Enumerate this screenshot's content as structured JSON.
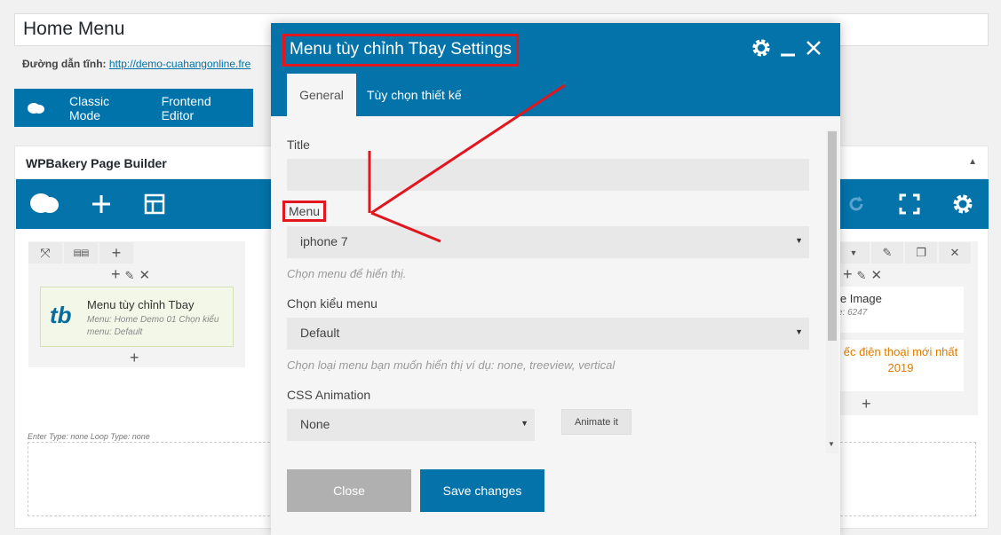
{
  "post": {
    "title": "Home Menu",
    "permalink_label": "Đường dẫn tĩnh:",
    "permalink_url": "http://demo-cuahangonline.fre"
  },
  "modes": {
    "classic": "Classic Mode",
    "frontend": "Frontend Editor"
  },
  "builder": {
    "heading": "WPBakery Page Builder",
    "element": {
      "logo": "tb",
      "name": "Menu tùy chỉnh Tbay",
      "desc": "Menu: Home Demo 01  Chọn kiểu menu: Default"
    },
    "enter_type": "Enter Type: none  Loop Type: none",
    "right": {
      "card1_title": "le Image",
      "card1_sub": "e: 6247",
      "card2_line1": "ếc điện thoại mới nhất",
      "card2_line2": "2019"
    }
  },
  "modal": {
    "title": "Menu tùy chỉnh Tbay Settings",
    "tabs": [
      "General",
      "Tùy chọn thiết kế"
    ],
    "fields": {
      "title_label": "Title",
      "title_value": "",
      "menu_label": "Menu",
      "menu_value": "iphone 7",
      "menu_hint": "Chọn menu để hiển thị.",
      "style_label": "Chọn kiểu menu",
      "style_value": "Default",
      "style_hint": "Chọn loại menu bạn muốn hiển thị ví dụ: none, treeview, vertical",
      "anim_label": "CSS Animation",
      "anim_value": "None",
      "anim_button": "Animate it"
    },
    "close_label": "Close",
    "save_label": "Save changes"
  },
  "colors": {
    "brand": "#0473aa",
    "annotation": "#e1161f",
    "accent_text": "#e07b00"
  },
  "icons": [
    "gear-icon",
    "minimize-icon",
    "close-icon",
    "add-icon",
    "template-icon",
    "fullscreen-icon",
    "redo-icon",
    "pencil-icon",
    "copy-icon",
    "move-icon"
  ]
}
